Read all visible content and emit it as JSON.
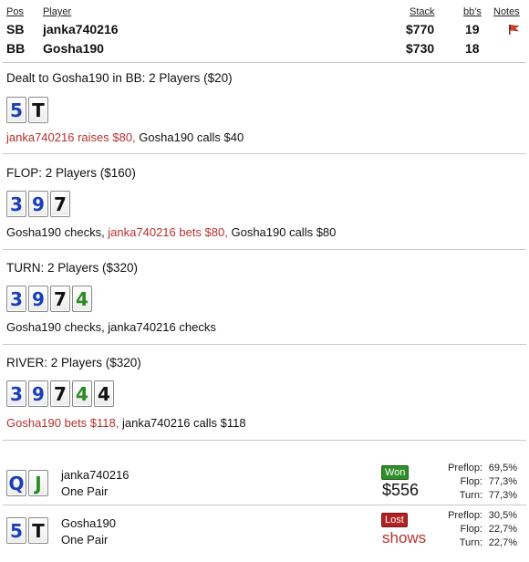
{
  "header": {
    "col_pos": "Pos",
    "col_player": "Player",
    "col_stack": "Stack",
    "col_bbs": "bb's",
    "col_notes": "Notes",
    "rows": [
      {
        "pos": "SB",
        "player": "janka740216",
        "stack": "$770",
        "bbs": "19",
        "note_icon": "red-flag-icon"
      },
      {
        "pos": "BB",
        "player": "Gosha190",
        "stack": "$730",
        "bbs": "18"
      }
    ]
  },
  "preflop": {
    "title": "Dealt to Gosha190 in BB: 2 Players ($20)",
    "cards": [
      {
        "rank": "5",
        "suit": "blue"
      },
      {
        "rank": "T",
        "suit": "black"
      }
    ],
    "action_red": "janka740216 raises $80,",
    "action_rest": " Gosha190 calls $40"
  },
  "flop": {
    "title": "FLOP: 2 Players ($160)",
    "cards": [
      {
        "rank": "3",
        "suit": "blue"
      },
      {
        "rank": "9",
        "suit": "blue"
      },
      {
        "rank": "7",
        "suit": "black"
      }
    ],
    "action_pre": "Gosha190 checks, ",
    "action_red": "janka740216 bets $80,",
    "action_rest": " Gosha190 calls $80"
  },
  "turn": {
    "title": "TURN: 2 Players ($320)",
    "cards": [
      {
        "rank": "3",
        "suit": "blue"
      },
      {
        "rank": "9",
        "suit": "blue"
      },
      {
        "rank": "7",
        "suit": "black"
      },
      {
        "rank": "4",
        "suit": "green"
      }
    ],
    "action": "Gosha190 checks, janka740216 checks"
  },
  "river": {
    "title": "RIVER: 2 Players ($320)",
    "cards": [
      {
        "rank": "3",
        "suit": "blue"
      },
      {
        "rank": "9",
        "suit": "blue"
      },
      {
        "rank": "7",
        "suit": "black"
      },
      {
        "rank": "4",
        "suit": "green"
      },
      {
        "rank": "4",
        "suit": "black"
      }
    ],
    "action_red": "Gosha190 bets $118,",
    "action_rest": " janka740216 calls $118"
  },
  "results": [
    {
      "player": "janka740216",
      "hand": "One Pair",
      "cards": [
        {
          "rank": "Q",
          "suit": "blue"
        },
        {
          "rank": "J",
          "suit": "green"
        }
      ],
      "badge": "Won",
      "outcome_text": "$556",
      "stats": [
        {
          "label": "Preflop:",
          "value": "69,5%"
        },
        {
          "label": "Flop:",
          "value": "77,3%"
        },
        {
          "label": "Turn:",
          "value": "77,3%"
        }
      ]
    },
    {
      "player": "Gosha190",
      "hand": "One Pair",
      "cards": [
        {
          "rank": "5",
          "suit": "blue"
        },
        {
          "rank": "T",
          "suit": "black"
        }
      ],
      "badge": "Lost",
      "outcome_text": "shows",
      "stats": [
        {
          "label": "Preflop:",
          "value": "30,5%"
        },
        {
          "label": "Flop:",
          "value": "22,7%"
        },
        {
          "label": "Turn:",
          "value": "22,7%"
        }
      ]
    }
  ],
  "colors": {
    "action_red": "#b8312f",
    "suit_blue": "#1a3fb8",
    "suit_black": "#111111",
    "suit_green": "#2a8a22",
    "won_badge": "#2f8e2a",
    "lost_badge": "#b22222"
  }
}
